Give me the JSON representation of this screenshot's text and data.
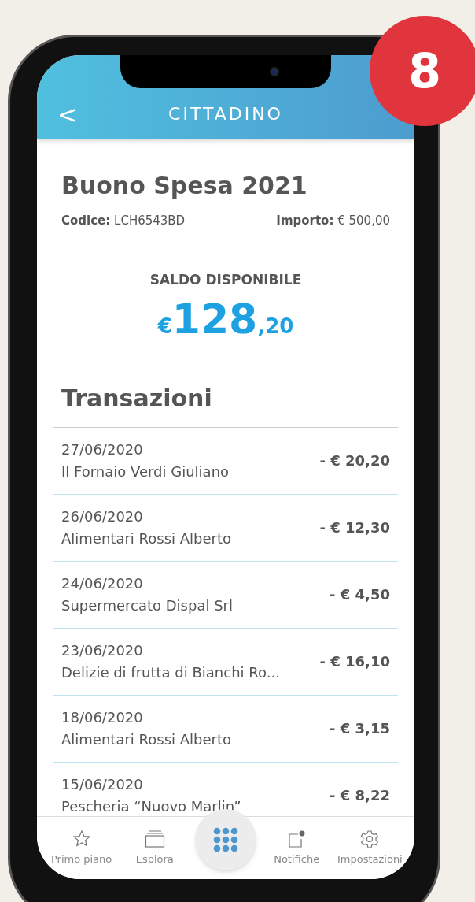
{
  "badge": "8",
  "header": {
    "back": "<",
    "title": "CITTADINO"
  },
  "voucher": {
    "title": "Buono Spesa 2021",
    "code_label": "Codice:",
    "code": "LCH6543BD",
    "amount_label": "Importo:",
    "amount": "€ 500,00"
  },
  "balance": {
    "label": "SALDO DISPONIBILE",
    "currency": "€",
    "integer": "128",
    "decimals": ",20"
  },
  "transactions": {
    "title": "Transazioni",
    "rows": [
      {
        "date": "27/06/2020",
        "merchant": "Il Fornaio Verdi Giuliano",
        "amount": "- € 20,20"
      },
      {
        "date": "26/06/2020",
        "merchant": "Alimentari Rossi Alberto",
        "amount": "- € 12,30"
      },
      {
        "date": "24/06/2020",
        "merchant": "Supermercato Dispal Srl",
        "amount": "- € 4,50"
      },
      {
        "date": "23/06/2020",
        "merchant": "Delizie di frutta di Bianchi Ro...",
        "amount": "- € 16,10"
      },
      {
        "date": "18/06/2020",
        "merchant": "Alimentari Rossi Alberto",
        "amount": "- € 3,15"
      },
      {
        "date": "15/06/2020",
        "merchant": "Pescheria “Nuovo Marlin”",
        "amount": "- € 8,22"
      }
    ]
  },
  "bottom_nav": [
    {
      "kind": "tab",
      "label": "Primo piano"
    },
    {
      "kind": "tab",
      "label": "Esplora"
    },
    {
      "kind": "center"
    },
    {
      "kind": "tab",
      "label": "Notifiche"
    },
    {
      "kind": "tab",
      "label": "Impostazioni"
    }
  ]
}
